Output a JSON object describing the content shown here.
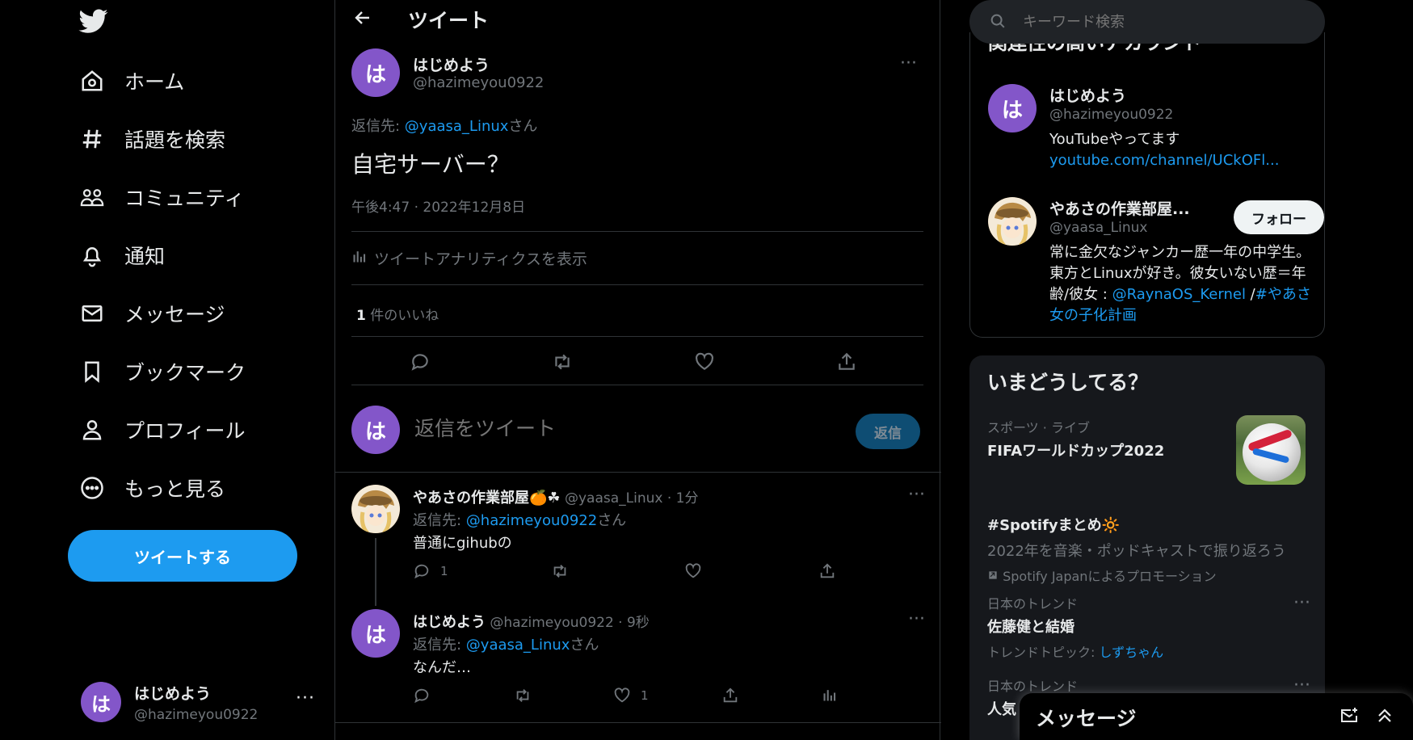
{
  "colors": {
    "accent": "#1d9bf0",
    "avatar": "#8356c9",
    "muted": "#71767b",
    "bg": "#000000"
  },
  "nav": {
    "items": [
      {
        "label": "ホーム",
        "icon": "home-icon"
      },
      {
        "label": "話題を検索",
        "icon": "hash-icon"
      },
      {
        "label": "コミュニティ",
        "icon": "communities-icon"
      },
      {
        "label": "通知",
        "icon": "bell-icon"
      },
      {
        "label": "メッセージ",
        "icon": "mail-icon"
      },
      {
        "label": "ブックマーク",
        "icon": "bookmark-icon"
      },
      {
        "label": "プロフィール",
        "icon": "profile-icon"
      },
      {
        "label": "もっと見る",
        "icon": "more-circle-icon"
      }
    ],
    "tweet_button": "ツイートする"
  },
  "account": {
    "avatar_char": "は",
    "name": "はじめよう",
    "handle": "@hazimeyou0922",
    "more": "···"
  },
  "main": {
    "header_title": "ツイート",
    "tweet": {
      "avatar_char": "は",
      "name": "はじめよう",
      "handle": "@hazimeyou0922",
      "reply_to_prefix": "返信先: ",
      "reply_to_handle": "@yaasa_Linux",
      "reply_to_suffix": "さん",
      "text": "自宅サーバー？",
      "time": "午後4:47 · 2022年12月8日",
      "analytics": "ツイートアナリティクスを表示",
      "likes_count": "1",
      "likes_label": " 件のいいね"
    },
    "compose": {
      "avatar_char": "は",
      "placeholder": "返信をツイート",
      "button": "返信"
    },
    "replies": [
      {
        "name": "やあさの作業部屋🍊☘",
        "meta": " @yaasa_Linux · 1分",
        "reply_to_prefix": "返信先: ",
        "reply_to_handle": "@hazimeyou0922",
        "reply_to_suffix": "さん",
        "text": "普通にgihubの",
        "reply_count": "1",
        "like_count": ""
      },
      {
        "avatar_char": "は",
        "name": "はじめよう",
        "meta": " @hazimeyou0922 · 9秒",
        "reply_to_prefix": "返信先: ",
        "reply_to_handle": "@yaasa_Linux",
        "reply_to_suffix": "さん",
        "text": "なんだ…",
        "reply_count": "",
        "like_count": "1"
      }
    ]
  },
  "right": {
    "search_placeholder": "キーワード検索",
    "related_title": "関連性の高いアカウント",
    "accounts": [
      {
        "avatar_char": "は",
        "name": "はじめよう",
        "handle": "@hazimeyou0922",
        "bio": "YouTubeやってます",
        "link": "youtube.com/channel/UCkOFl..."
      },
      {
        "name": "やあさの作業部屋...",
        "handle": "@yaasa_Linux",
        "follow": "フォロー",
        "bio": "常に金欠なジャンカー歴一年の中学生。東方とLinuxが好き。彼女いない歴＝年齢/彼女 : ",
        "bio_link": "@RaynaOS_Kernel",
        "bio_sep": " /",
        "bio_tag": "#やあさ女の子化計画"
      }
    ],
    "trends_title": "いまどうしてる？",
    "trends": [
      {
        "category": "スポーツ · ライブ",
        "title": "FIFAワールドカップ2022"
      },
      {
        "title": "#Spotifyまとめ🔆",
        "subtitle": "2022年を音楽・ポッドキャストで振り返ろう",
        "promo": "Spotify Japanによるプロモーション"
      },
      {
        "category": "日本のトレンド",
        "title": "佐藤健と結婚",
        "topic_prefix": "トレンドトピック: ",
        "topic": "しずちゃん"
      },
      {
        "category": "日本のトレンド",
        "title": "人気"
      }
    ]
  },
  "messages_dock": {
    "title": "メッセージ"
  }
}
